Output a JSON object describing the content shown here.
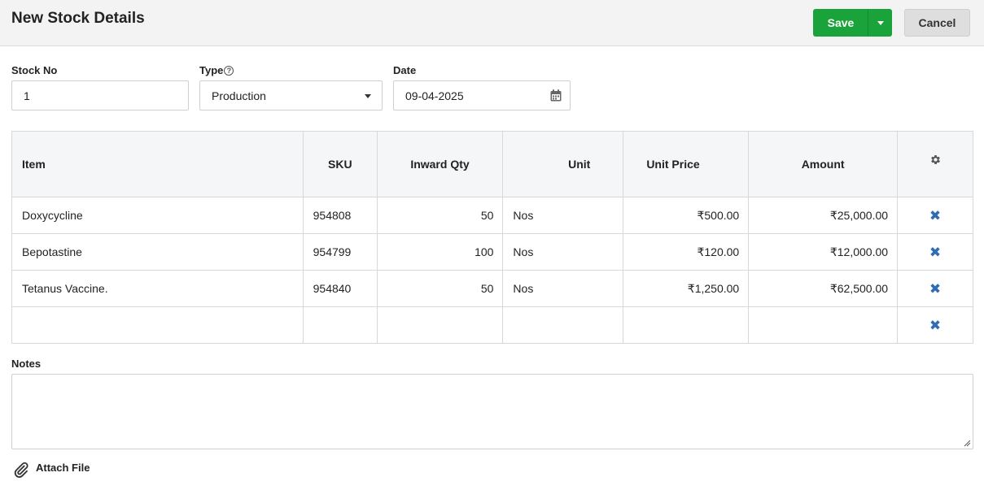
{
  "header": {
    "title": "New Stock Details",
    "save_label": "Save",
    "cancel_label": "Cancel"
  },
  "form": {
    "stock_no_label": "Stock No",
    "stock_no_value": "1",
    "type_label": "Type",
    "type_value": "Production",
    "date_label": "Date",
    "date_value": "09-04-2025"
  },
  "table": {
    "columns": [
      "Item",
      "SKU",
      "Inward Qty",
      "Unit",
      "Unit Price",
      "Amount"
    ],
    "rows": [
      {
        "item": "Doxycycline",
        "sku": "954808",
        "qty": "50",
        "unit": "Nos",
        "unit_price": "₹500.00",
        "amount": "₹25,000.00"
      },
      {
        "item": "Bepotastine",
        "sku": "954799",
        "qty": "100",
        "unit": "Nos",
        "unit_price": "₹120.00",
        "amount": "₹12,000.00"
      },
      {
        "item": "Tetanus Vaccine.",
        "sku": "954840",
        "qty": "50",
        "unit": "Nos",
        "unit_price": "₹1,250.00",
        "amount": "₹62,500.00"
      },
      {
        "item": "",
        "sku": "",
        "qty": "",
        "unit": "",
        "unit_price": "",
        "amount": ""
      }
    ]
  },
  "notes": {
    "label": "Notes",
    "value": ""
  },
  "attach": {
    "label": "Attach File"
  },
  "icons": {
    "type_help": "question-circle-icon",
    "date": "calendar-icon",
    "columns_settings": "gear-icon",
    "row_delete": "close-icon",
    "attach": "paperclip-icon"
  },
  "colors": {
    "save_button": "#1aa33a",
    "cancel_button": "#dedede",
    "delete_icon": "#2e6db4",
    "header_bg": "#f3f3f3"
  }
}
